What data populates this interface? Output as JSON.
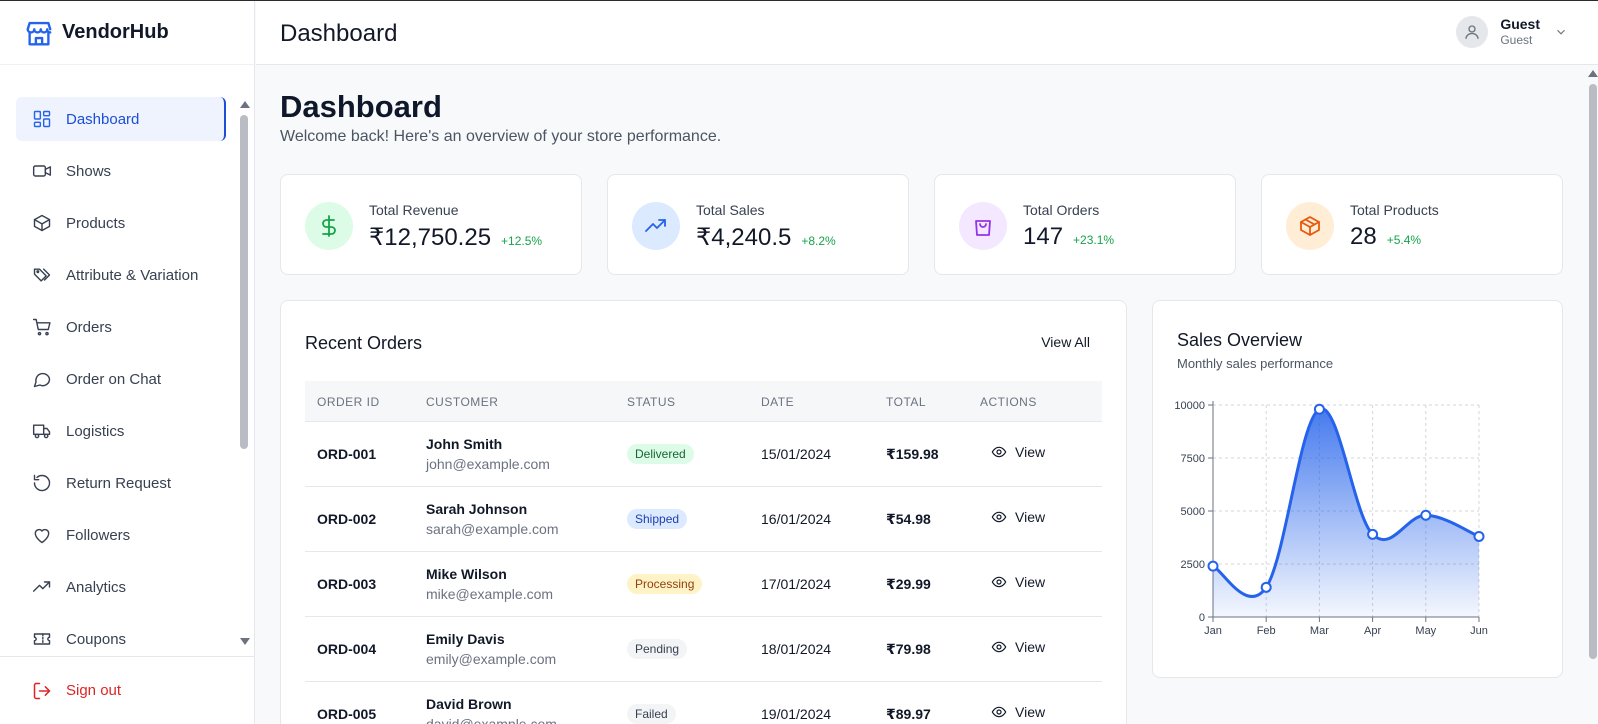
{
  "brand": {
    "name": "VendorHub",
    "color": "#2563eb"
  },
  "header": {
    "title": "Dashboard",
    "user_name": "Guest",
    "user_role": "Guest"
  },
  "sidebar": {
    "items": [
      {
        "label": "Dashboard",
        "icon": "layout-grid-icon",
        "active": true
      },
      {
        "label": "Shows",
        "icon": "video-icon"
      },
      {
        "label": "Products",
        "icon": "box-icon"
      },
      {
        "label": "Attribute & Variation",
        "icon": "tags-icon"
      },
      {
        "label": "Orders",
        "icon": "cart-icon"
      },
      {
        "label": "Order on Chat",
        "icon": "chat-icon"
      },
      {
        "label": "Logistics",
        "icon": "truck-icon"
      },
      {
        "label": "Return Request",
        "icon": "return-icon"
      },
      {
        "label": "Followers",
        "icon": "heart-icon"
      },
      {
        "label": "Analytics",
        "icon": "trend-icon"
      },
      {
        "label": "Coupons",
        "icon": "ticket-icon"
      }
    ],
    "signout": "Sign out"
  },
  "main": {
    "title": "Dashboard",
    "subtitle": "Welcome back! Here's an overview of your store performance."
  },
  "stats": [
    {
      "label": "Total Revenue",
      "value": "₹12,750.25",
      "change": "+12.5%",
      "icon": "dollar-icon"
    },
    {
      "label": "Total Sales",
      "value": "₹4,240.5",
      "change": "+8.2%",
      "icon": "trend-up-icon"
    },
    {
      "label": "Total Orders",
      "value": "147",
      "change": "+23.1%",
      "icon": "shopping-bag-icon"
    },
    {
      "label": "Total Products",
      "value": "28",
      "change": "+5.4%",
      "icon": "package-icon"
    }
  ],
  "orders": {
    "title": "Recent Orders",
    "view_all": "View All",
    "columns": [
      "ORDER ID",
      "CUSTOMER",
      "STATUS",
      "DATE",
      "TOTAL",
      "ACTIONS"
    ],
    "rows": [
      {
        "id": "ORD-001",
        "name": "John Smith",
        "email": "john@example.com",
        "status": "Delivered",
        "date": "15/01/2024",
        "total": "₹159.98",
        "action": "View"
      },
      {
        "id": "ORD-002",
        "name": "Sarah Johnson",
        "email": "sarah@example.com",
        "status": "Shipped",
        "date": "16/01/2024",
        "total": "₹54.98",
        "action": "View"
      },
      {
        "id": "ORD-003",
        "name": "Mike Wilson",
        "email": "mike@example.com",
        "status": "Processing",
        "date": "17/01/2024",
        "total": "₹29.99",
        "action": "View"
      },
      {
        "id": "ORD-004",
        "name": "Emily Davis",
        "email": "emily@example.com",
        "status": "Pending",
        "date": "18/01/2024",
        "total": "₹79.98",
        "action": "View"
      },
      {
        "id": "ORD-005",
        "name": "David Brown",
        "email": "david@example.com",
        "status": "Failed",
        "date": "19/01/2024",
        "total": "₹89.97",
        "action": "View"
      }
    ]
  },
  "sales_overview": {
    "title": "Sales Overview",
    "subtitle": "Monthly sales performance"
  },
  "chart_data": {
    "type": "area",
    "title": "Sales Overview",
    "subtitle": "Monthly sales performance",
    "categories": [
      "Jan",
      "Feb",
      "Mar",
      "Apr",
      "May",
      "Jun"
    ],
    "series": [
      {
        "values": [
          2400,
          1400,
          9800,
          3900,
          4800,
          3800
        ]
      }
    ],
    "ylim": [
      0,
      10000
    ],
    "yticks": [
      0,
      2500,
      5000,
      7500,
      10000
    ],
    "grid": true,
    "legend": "none",
    "color": "#2563eb"
  }
}
